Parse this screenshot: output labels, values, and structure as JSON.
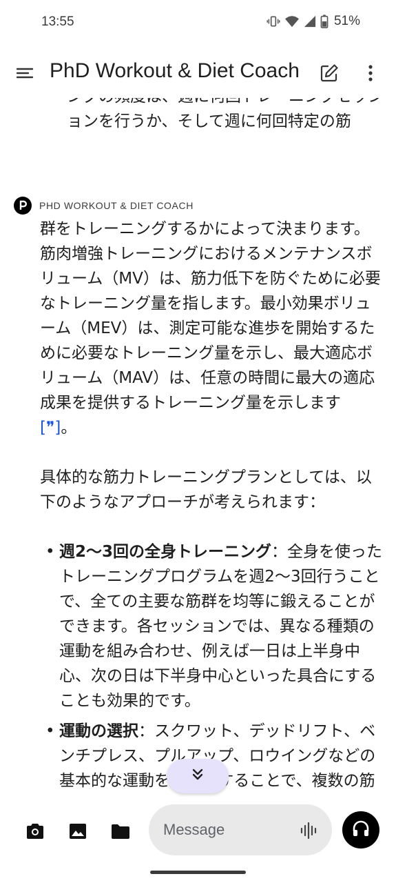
{
  "status": {
    "time": "13:55",
    "battery": "51%"
  },
  "app_bar": {
    "title": "PhD Workout & Diet Coach"
  },
  "chat": {
    "previous_message_tail": "ングの頻度は、週に何回トレーニングセッションを行うか、そして週に何回特定の筋",
    "sender": "PHD WORKOUT & DIET COACH",
    "paragraph1": "群をトレーニングするかによって決まります。筋肉増強トレーニングにおけるメンテナンスボリューム（MV）は、筋力低下を防ぐために必要なトレーニング量を指します。最小効果ボリューム（MEV）は、測定可能な進歩を開始するために必要なトレーニング量を示し、最大適応ボリューム（MAV）は、任意の時間に最大の適応成果を提供するトレーニング量を示します ",
    "citation": "[❞]",
    "paragraph1_end": "。",
    "paragraph2": "具体的な筋力トレーニングプランとしては、以下のようなアプローチが考えられます：",
    "bullets": [
      {
        "title": "週2〜3回の全身トレーニング",
        "text": "：全身を使ったトレーニングプログラムを週2〜3回行うことで、全ての主要な筋群を均等に鍛えることができます。各セッションでは、異なる種類の運動を組み合わせ、例えば一日は上半身中心、次の日は下半身中心といった具合にすることも効果的です。"
      },
      {
        "title": "運動の選択",
        "text": "：スクワット、デッドリフト、ベンチプレス、プルアップ、ロウイングなどの基本的な運動を中心にすることで、複数の筋群を同時"
      }
    ]
  },
  "input": {
    "placeholder": "Message"
  },
  "icons": {
    "menu": "menu-icon",
    "edit": "edit-icon",
    "more": "more-vert-icon",
    "camera": "camera-icon",
    "gallery": "image-icon",
    "folder": "folder-icon",
    "voice": "voice-waveform-icon",
    "headset": "headset-icon",
    "scroll": "double-chevron-down-icon"
  }
}
